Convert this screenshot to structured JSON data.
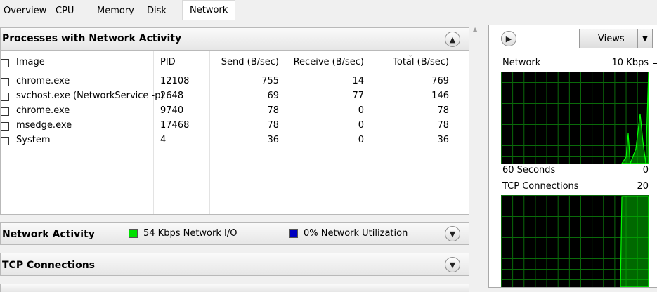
{
  "tabs": [
    {
      "label": "Overview"
    },
    {
      "label": "CPU"
    },
    {
      "label": "Memory"
    },
    {
      "label": "Disk"
    },
    {
      "label": "Network",
      "active": true
    }
  ],
  "processes": {
    "title": "Processes with Network Activity",
    "columns": {
      "image": "Image",
      "pid": "PID",
      "send": "Send (B/sec)",
      "receive": "Receive (B/sec)",
      "total": "Total (B/sec)"
    },
    "rows": [
      {
        "image": "chrome.exe",
        "pid": "12108",
        "send": "755",
        "receive": "14",
        "total": "769"
      },
      {
        "image": "svchost.exe (NetworkService -p)",
        "pid": "2648",
        "send": "69",
        "receive": "77",
        "total": "146"
      },
      {
        "image": "chrome.exe",
        "pid": "9740",
        "send": "78",
        "receive": "0",
        "total": "78"
      },
      {
        "image": "msedge.exe",
        "pid": "17468",
        "send": "78",
        "receive": "0",
        "total": "78"
      },
      {
        "image": "System",
        "pid": "4",
        "send": "36",
        "receive": "0",
        "total": "36"
      }
    ]
  },
  "network_activity": {
    "title": "Network Activity",
    "io_label": "54 Kbps Network I/O",
    "util_label": "0% Network Utilization",
    "io_color": "#00e000",
    "util_color": "#0000c0"
  },
  "tcp_section": {
    "title": "TCP Connections"
  },
  "right_pane": {
    "views_label": "Views",
    "network_graph": {
      "label": "Network",
      "max_label": "10 Kbps",
      "time_label": "60 Seconds",
      "min_label": "0"
    },
    "tcp_graph": {
      "label": "TCP Connections",
      "max_label": "20"
    }
  },
  "colors": {
    "graph_bg": "#000000",
    "graph_grid": "#0a6a0a",
    "graph_line": "#00ff00"
  }
}
